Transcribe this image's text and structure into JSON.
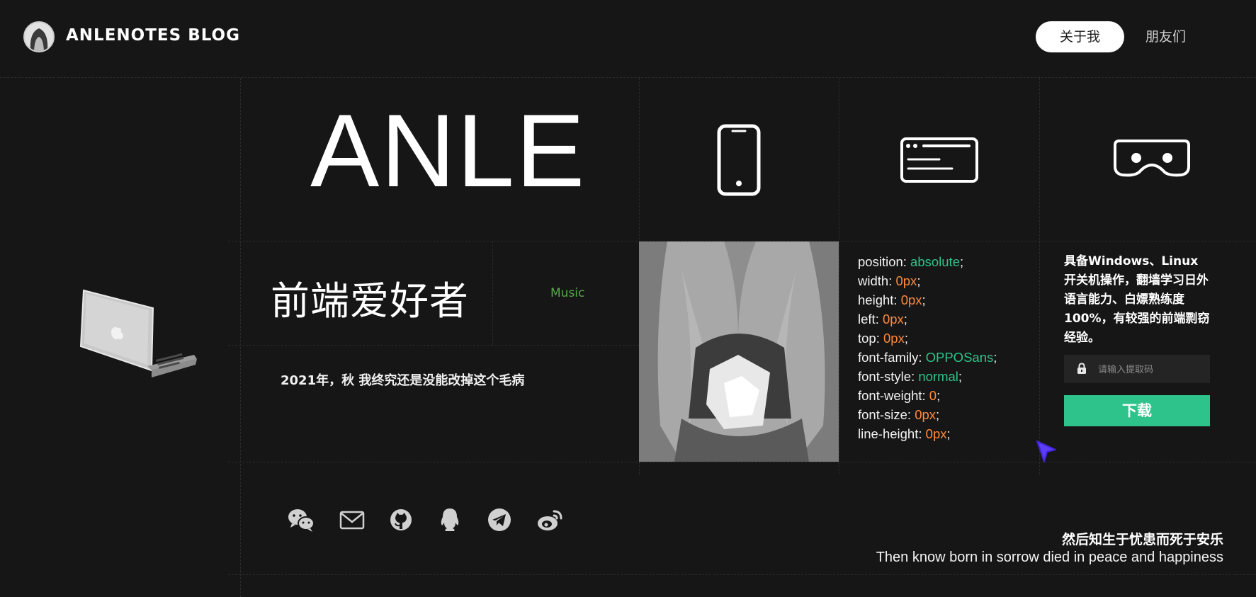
{
  "header": {
    "brand": "ANLENOTES BLOG",
    "nav": [
      {
        "label": "关于我",
        "active": true
      },
      {
        "label": "朋友们",
        "active": false
      }
    ]
  },
  "hero": {
    "title": "ANLE",
    "role": "前端爱好者",
    "music_link": "Music",
    "diary": "2021年，秋 我终究还是没能改掉这个毛病"
  },
  "icons": [
    "laptop-icon",
    "phone-icon",
    "browser-window-icon",
    "vr-glasses-icon"
  ],
  "css_props": [
    {
      "prop": "position",
      "value": "absolute",
      "kind": "keyword"
    },
    {
      "prop": "width",
      "value": "0px",
      "kind": "number"
    },
    {
      "prop": "height",
      "value": "0px",
      "kind": "number"
    },
    {
      "prop": "left",
      "value": "0px",
      "kind": "number"
    },
    {
      "prop": "top",
      "value": "0px",
      "kind": "number"
    },
    {
      "prop": "font-family",
      "value": "OPPOSans",
      "kind": "keyword"
    },
    {
      "prop": "font-style",
      "value": "normal",
      "kind": "keyword"
    },
    {
      "prop": "font-weight",
      "value": "0",
      "kind": "number"
    },
    {
      "prop": "font-size",
      "value": "0px",
      "kind": "number"
    },
    {
      "prop": "line-height",
      "value": "0px",
      "kind": "number"
    }
  ],
  "skills": {
    "text": "具备Windows、Linux开关机操作，翻墙学习日外语言能力、白嫖熟练度100%，有较强的前端剽窃经验。",
    "code_placeholder": "请输入提取码",
    "download_label": "下载"
  },
  "social": [
    "wechat-icon",
    "mail-icon",
    "github-icon",
    "qq-icon",
    "telegram-icon",
    "weibo-icon"
  ],
  "quote": {
    "cn": "然后知生于忧患而死于安乐",
    "en": "Then know born in sorrow died in peace and happiness"
  },
  "colors": {
    "background": "#161616",
    "accent": "#2ec38a",
    "number": "#ff8a3d",
    "music": "#57a64a",
    "cursor": "#5b3df5"
  }
}
